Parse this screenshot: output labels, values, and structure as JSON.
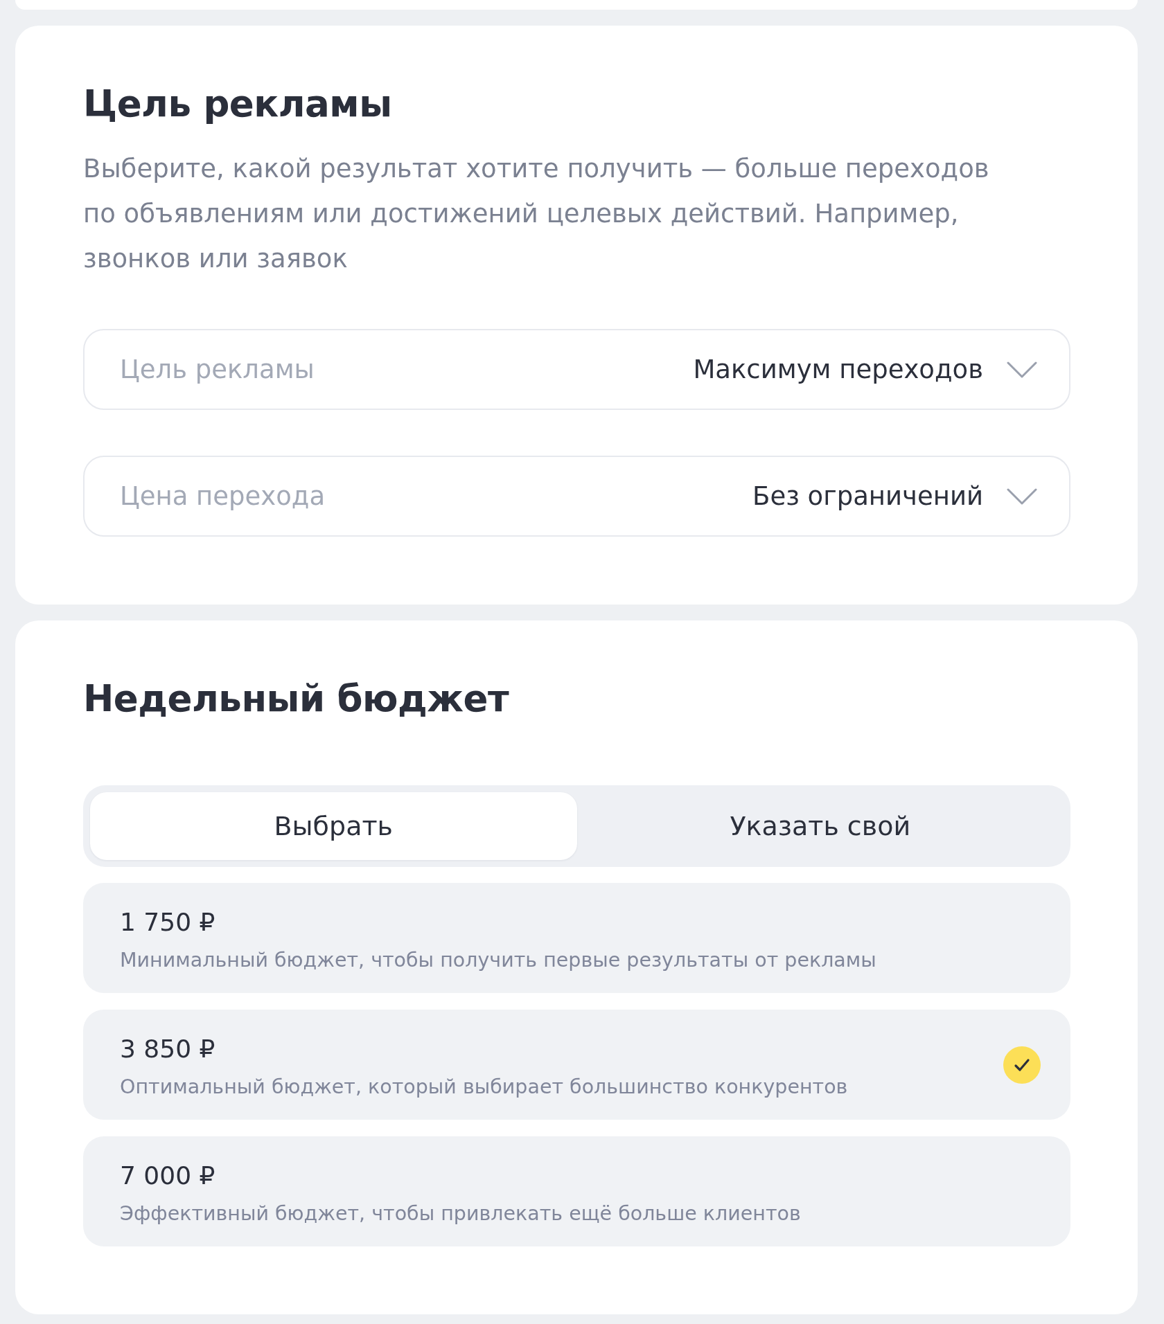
{
  "goal_section": {
    "title": "Цель рекламы",
    "description": "Выберите, какой результат хотите получить — больше переходов по объявлениям или достижений целевых действий. Например, звонков или заявок",
    "fields": [
      {
        "label": "Цель рекламы",
        "value": "Максимум переходов"
      },
      {
        "label": "Цена перехода",
        "value": "Без ограничений"
      }
    ]
  },
  "budget_section": {
    "title": "Недельный бюджет",
    "tabs": [
      {
        "label": "Выбрать",
        "selected": true
      },
      {
        "label": "Указать свой",
        "selected": false
      }
    ],
    "options": [
      {
        "amount": "1 750 ₽",
        "description": "Минимальный бюджет, чтобы получить первые результаты от рекламы",
        "selected": false
      },
      {
        "amount": "3 850 ₽",
        "description": "Оптимальный бюджет, который выбирает большинство конкурентов",
        "selected": true
      },
      {
        "amount": "7 000 ₽",
        "description": "Эффективный бюджет, чтобы привлекать ещё больше клиентов",
        "selected": false
      }
    ]
  }
}
